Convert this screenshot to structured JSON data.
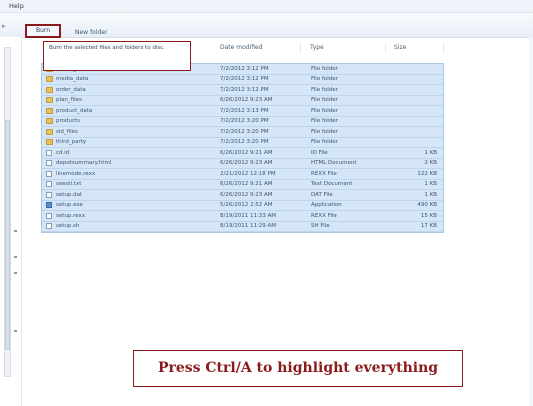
{
  "menu": {
    "help": "Help"
  },
  "toolbar": {
    "burn_label": "Burn",
    "new_folder_label": "New folder"
  },
  "tooltip": {
    "text": "Burn the selected files and folders to disc."
  },
  "columns": {
    "date_modified": "Date modified",
    "type": "Type",
    "size": "Size"
  },
  "files": [
    {
      "name": "media_disc",
      "date": "7/2/2012 3:12 PM",
      "type": "File folder",
      "size": "",
      "icon": "folder-icon"
    },
    {
      "name": "media_data",
      "date": "7/2/2012 3:12 PM",
      "type": "File folder",
      "size": "",
      "icon": "folder-icon"
    },
    {
      "name": "order_data",
      "date": "7/2/2012 3:12 PM",
      "type": "File folder",
      "size": "",
      "icon": "folder-icon"
    },
    {
      "name": "plan_files",
      "date": "6/26/2012 9:23 AM",
      "type": "File folder",
      "size": "",
      "icon": "folder-icon"
    },
    {
      "name": "product_data",
      "date": "7/2/2012 3:13 PM",
      "type": "File folder",
      "size": "",
      "icon": "folder-icon"
    },
    {
      "name": "products",
      "date": "7/2/2012 3:20 PM",
      "type": "File folder",
      "size": "",
      "icon": "folder-icon"
    },
    {
      "name": "sid_files",
      "date": "7/2/2012 3:20 PM",
      "type": "File folder",
      "size": "",
      "icon": "folder-icon"
    },
    {
      "name": "third_party",
      "date": "7/2/2012 3:20 PM",
      "type": "File folder",
      "size": "",
      "icon": "folder-icon"
    },
    {
      "name": "cd.id",
      "date": "6/26/2012 9:21 AM",
      "type": "ID File",
      "size": "1 KB",
      "icon": "file-icon"
    },
    {
      "name": "depotsummary.html",
      "date": "6/26/2012 9:23 AM",
      "type": "HTML Document",
      "size": "2 KB",
      "icon": "html-file-icon"
    },
    {
      "name": "linemode.rexx",
      "date": "2/21/2012 12:18 PM",
      "type": "REXX File",
      "size": "122 KB",
      "icon": "file-icon"
    },
    {
      "name": "seeoil.txt",
      "date": "6/26/2012 9:21 AM",
      "type": "Text Document",
      "size": "1 KB",
      "icon": "file-icon"
    },
    {
      "name": "setup.dat",
      "date": "6/26/2012 9:23 AM",
      "type": "DAT File",
      "size": "1 KB",
      "icon": "file-icon"
    },
    {
      "name": "setup.exe",
      "date": "5/26/2012 2:52 AM",
      "type": "Application",
      "size": "490 KB",
      "icon": "app-icon"
    },
    {
      "name": "setup.rexx",
      "date": "8/19/2011 11:33 AM",
      "type": "REXX File",
      "size": "15 KB",
      "icon": "file-icon"
    },
    {
      "name": "setup.sh",
      "date": "8/19/2011 11:29 AM",
      "type": "SH File",
      "size": "17 KB",
      "icon": "file-icon"
    }
  ],
  "caption": "Press Ctrl/A to highlight everything",
  "colors": {
    "accent": "#8b1a1a",
    "selection": "#d4e6f8",
    "folder": "#e8c25a"
  }
}
